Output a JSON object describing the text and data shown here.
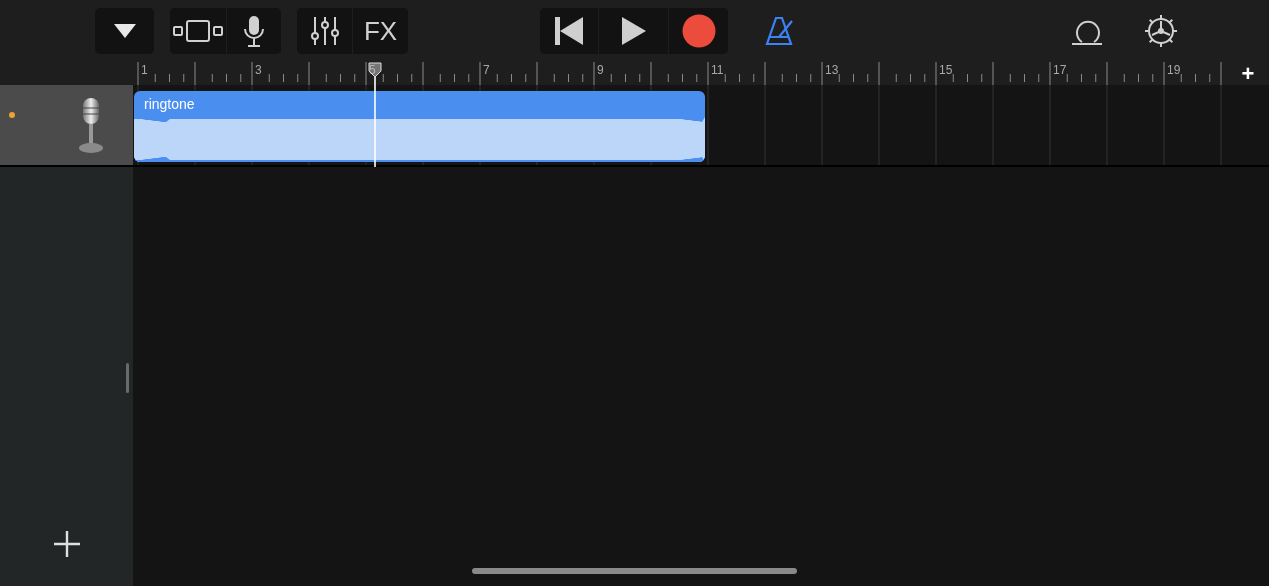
{
  "toolbar": {
    "fx_label": "FX",
    "metronome": {
      "on": true
    },
    "record": {
      "armed": true
    }
  },
  "ruler": {
    "add_label": "+",
    "bar_labels": [
      "1",
      "3",
      "5",
      "7",
      "9",
      "11",
      "13",
      "15",
      "17",
      "19"
    ]
  },
  "tracks": [
    {
      "selected": true,
      "region": {
        "name": "ringtone"
      }
    }
  ]
}
